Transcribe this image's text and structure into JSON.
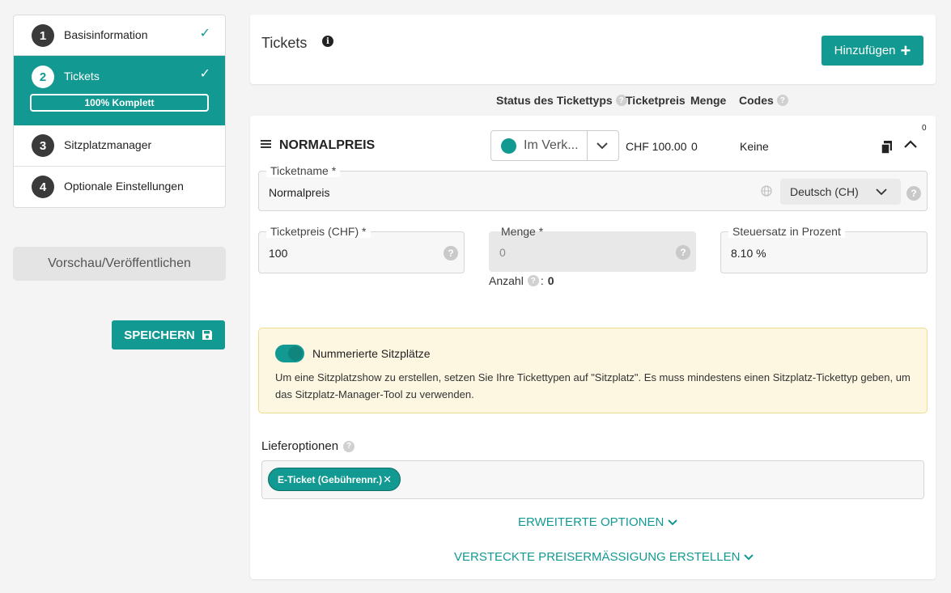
{
  "sidebar": {
    "steps": [
      {
        "num": "1",
        "label": "Basisinformation",
        "check": "✓"
      },
      {
        "num": "2",
        "label": "Tickets",
        "check": "✓",
        "progress": "100% Komplett"
      },
      {
        "num": "3",
        "label": "Sitzplatzmanager"
      },
      {
        "num": "4",
        "label": "Optionale Einstellungen"
      }
    ],
    "preview_label": "Vorschau/Veröffentlichen",
    "save_label": "SPEICHERN"
  },
  "header": {
    "title": "Tickets",
    "add_label": "Hinzufügen"
  },
  "columns": {
    "status": "Status des Tickettyps",
    "price": "Ticketpreis",
    "qty": "Menge",
    "codes": "Codes"
  },
  "ticket": {
    "name": "NORMALPREIS",
    "status": "Im Verk...",
    "price": "CHF 100.00",
    "qty": "0",
    "codes": "Keine",
    "counter": "0",
    "fields": {
      "ticketname_label": "Ticketname *",
      "ticketname_value": "Normalpreis",
      "language": "Deutsch (CH)",
      "price_label": "Ticketpreis (CHF) *",
      "price_value": "100",
      "qty_label": "Menge *",
      "qty_value": "0",
      "tax_label": "Steuersatz in Prozent",
      "tax_value": "8.10 %",
      "anzahl_label": "Anzahl",
      "anzahl_value": "0"
    },
    "seating": {
      "toggle_label": "Nummerierte Sitzplätze",
      "text": "Um eine Sitzplatzshow zu erstellen, setzen Sie Ihre Tickettypen auf \"Sitzplatz\". Es muss mindestens einen Sitzplatz-Tickettyp geben, um das Sitzplatz-Manager-Tool zu verwenden."
    },
    "delivery": {
      "title": "Lieferoptionen",
      "chip": "E-Ticket (Gebührennr.)"
    },
    "advanced_label": "ERWEITERTE OPTIONEN",
    "hidden_discount_label": "VERSTECKTE PREISERMÄSSIGUNG ERSTELLEN"
  },
  "colors": {
    "accent": "#129a92"
  }
}
